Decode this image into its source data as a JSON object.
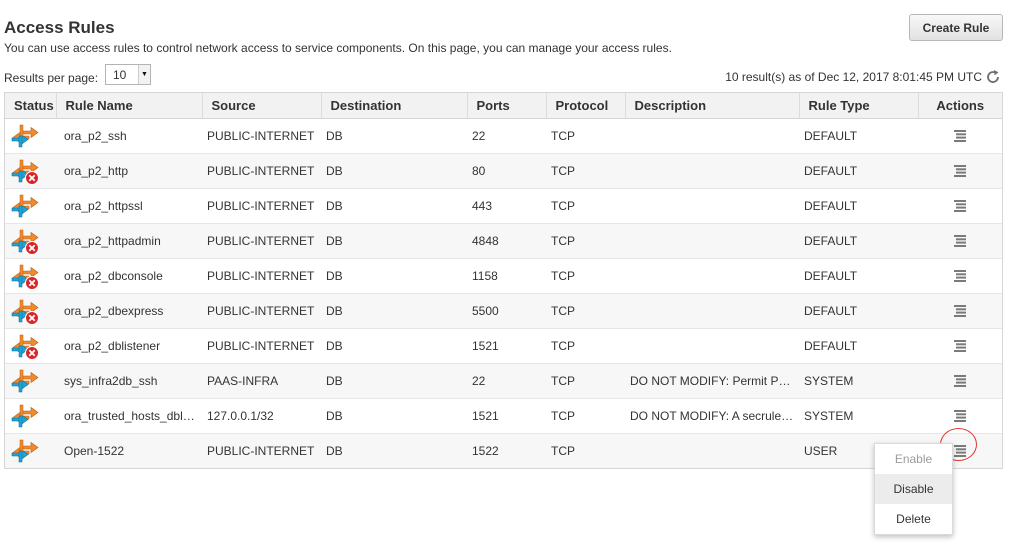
{
  "header": {
    "title": "Access Rules",
    "description": "You can use access rules to control network access to service components. On this page, you can manage your access rules.",
    "create_label": "Create Rule"
  },
  "pager": {
    "results_label": "Results per page:",
    "results_value": "10",
    "results_info": "10 result(s) as of Dec 12, 2017 8:01:45 PM UTC"
  },
  "table": {
    "columns": [
      "Status",
      "Rule Name",
      "Source",
      "Destination",
      "Ports",
      "Protocol",
      "Description",
      "Rule Type",
      "Actions"
    ],
    "rows": [
      {
        "status": "enabled",
        "name": "ora_p2_ssh",
        "source": "PUBLIC-INTERNET",
        "destination": "DB",
        "ports": "22",
        "protocol": "TCP",
        "description": "",
        "type": "DEFAULT"
      },
      {
        "status": "disabled",
        "name": "ora_p2_http",
        "source": "PUBLIC-INTERNET",
        "destination": "DB",
        "ports": "80",
        "protocol": "TCP",
        "description": "",
        "type": "DEFAULT"
      },
      {
        "status": "enabled",
        "name": "ora_p2_httpssl",
        "source": "PUBLIC-INTERNET",
        "destination": "DB",
        "ports": "443",
        "protocol": "TCP",
        "description": "",
        "type": "DEFAULT"
      },
      {
        "status": "disabled",
        "name": "ora_p2_httpadmin",
        "source": "PUBLIC-INTERNET",
        "destination": "DB",
        "ports": "4848",
        "protocol": "TCP",
        "description": "",
        "type": "DEFAULT"
      },
      {
        "status": "disabled",
        "name": "ora_p2_dbconsole",
        "source": "PUBLIC-INTERNET",
        "destination": "DB",
        "ports": "1158",
        "protocol": "TCP",
        "description": "",
        "type": "DEFAULT"
      },
      {
        "status": "disabled",
        "name": "ora_p2_dbexpress",
        "source": "PUBLIC-INTERNET",
        "destination": "DB",
        "ports": "5500",
        "protocol": "TCP",
        "description": "",
        "type": "DEFAULT"
      },
      {
        "status": "disabled",
        "name": "ora_p2_dblistener",
        "source": "PUBLIC-INTERNET",
        "destination": "DB",
        "ports": "1521",
        "protocol": "TCP",
        "description": "",
        "type": "DEFAULT"
      },
      {
        "status": "enabled",
        "name": "sys_infra2db_ssh",
        "source": "PAAS-INFRA",
        "destination": "DB",
        "ports": "22",
        "protocol": "TCP",
        "description": "DO NOT MODIFY: Permit P…",
        "type": "SYSTEM"
      },
      {
        "status": "enabled",
        "name": "ora_trusted_hosts_dbl…",
        "source": "127.0.0.1/32",
        "destination": "DB",
        "ports": "1521",
        "protocol": "TCP",
        "description": "DO NOT MODIFY: A secrule…",
        "type": "SYSTEM"
      },
      {
        "status": "enabled",
        "name": "Open-1522",
        "source": "PUBLIC-INTERNET",
        "destination": "DB",
        "ports": "1522",
        "protocol": "TCP",
        "description": "",
        "type": "USER"
      }
    ]
  },
  "context_menu": {
    "items": [
      {
        "label": "Enable",
        "disabled": true,
        "hover": false
      },
      {
        "label": "Disable",
        "disabled": false,
        "hover": true
      },
      {
        "label": "Delete",
        "disabled": false,
        "hover": false
      }
    ]
  },
  "icons": {
    "status_enabled": "rule-arrows-icon",
    "status_disabled": "rule-arrows-disabled-icon",
    "actions": "actions-menu-icon",
    "refresh": "refresh-icon"
  },
  "colors": {
    "arrow_orange": "#f08a2e",
    "arrow_blue": "#1ea4d8",
    "disabled_red": "#d8262b",
    "highlight_circle": "#e0362c"
  }
}
